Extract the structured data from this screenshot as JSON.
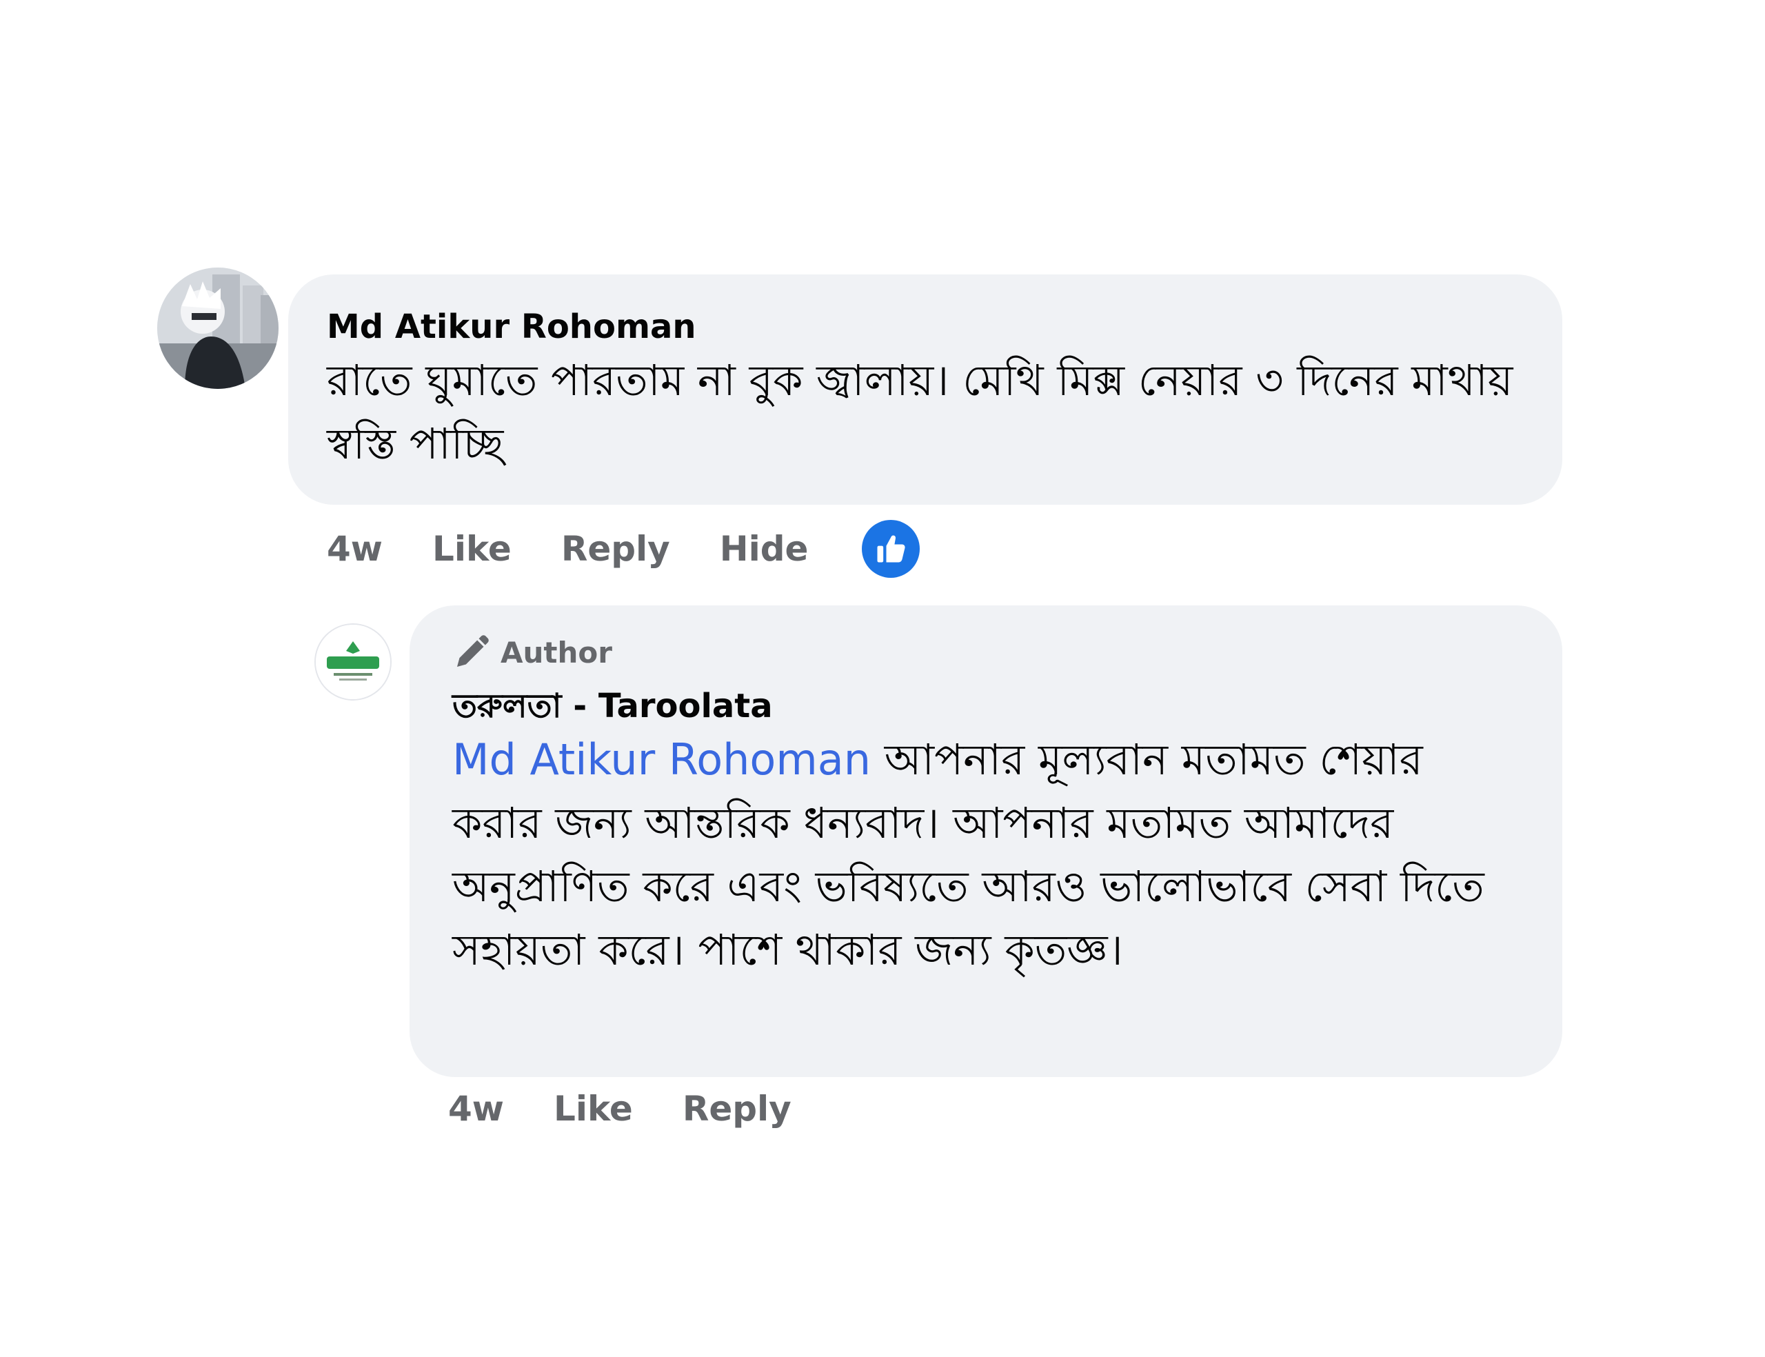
{
  "comment": {
    "author": "Md Atikur Rohoman",
    "text": "রাতে ঘুমাতে পারতাম না বুক জ্বালায়। মেথি মিক্স নেয়ার ৩ দিনের মাথায় স্বস্তি পাচ্ছি",
    "time": "4w",
    "actions": {
      "like": "Like",
      "reply": "Reply",
      "hide": "Hide"
    },
    "reaction_icon": "thumbs-up-icon",
    "reaction_color": "#1b74e4"
  },
  "reply": {
    "badge": "Author",
    "badge_icon": "pencil-icon",
    "author": "তরুলতা - Taroolata",
    "mention": "Md Atikur Rohoman",
    "text": " আপনার মূল্যবান মতামত শেয়ার করার জন্য আন্তরিক ধন্যবাদ। আপনার মতামত আমাদের অনুপ্রাণিত করে এবং ভবিষ্যতে আরও ভালোভাবে সেবা দিতে সহায়তা করে। পাশে থাকার জন্য কৃতজ্ঞ।",
    "time": "4w",
    "actions": {
      "like": "Like",
      "reply": "Reply"
    },
    "mention_color": "#3968e0"
  },
  "colors": {
    "bubble": "#f0f2f5",
    "meta_text": "#65676b",
    "primary_text": "#050505"
  }
}
